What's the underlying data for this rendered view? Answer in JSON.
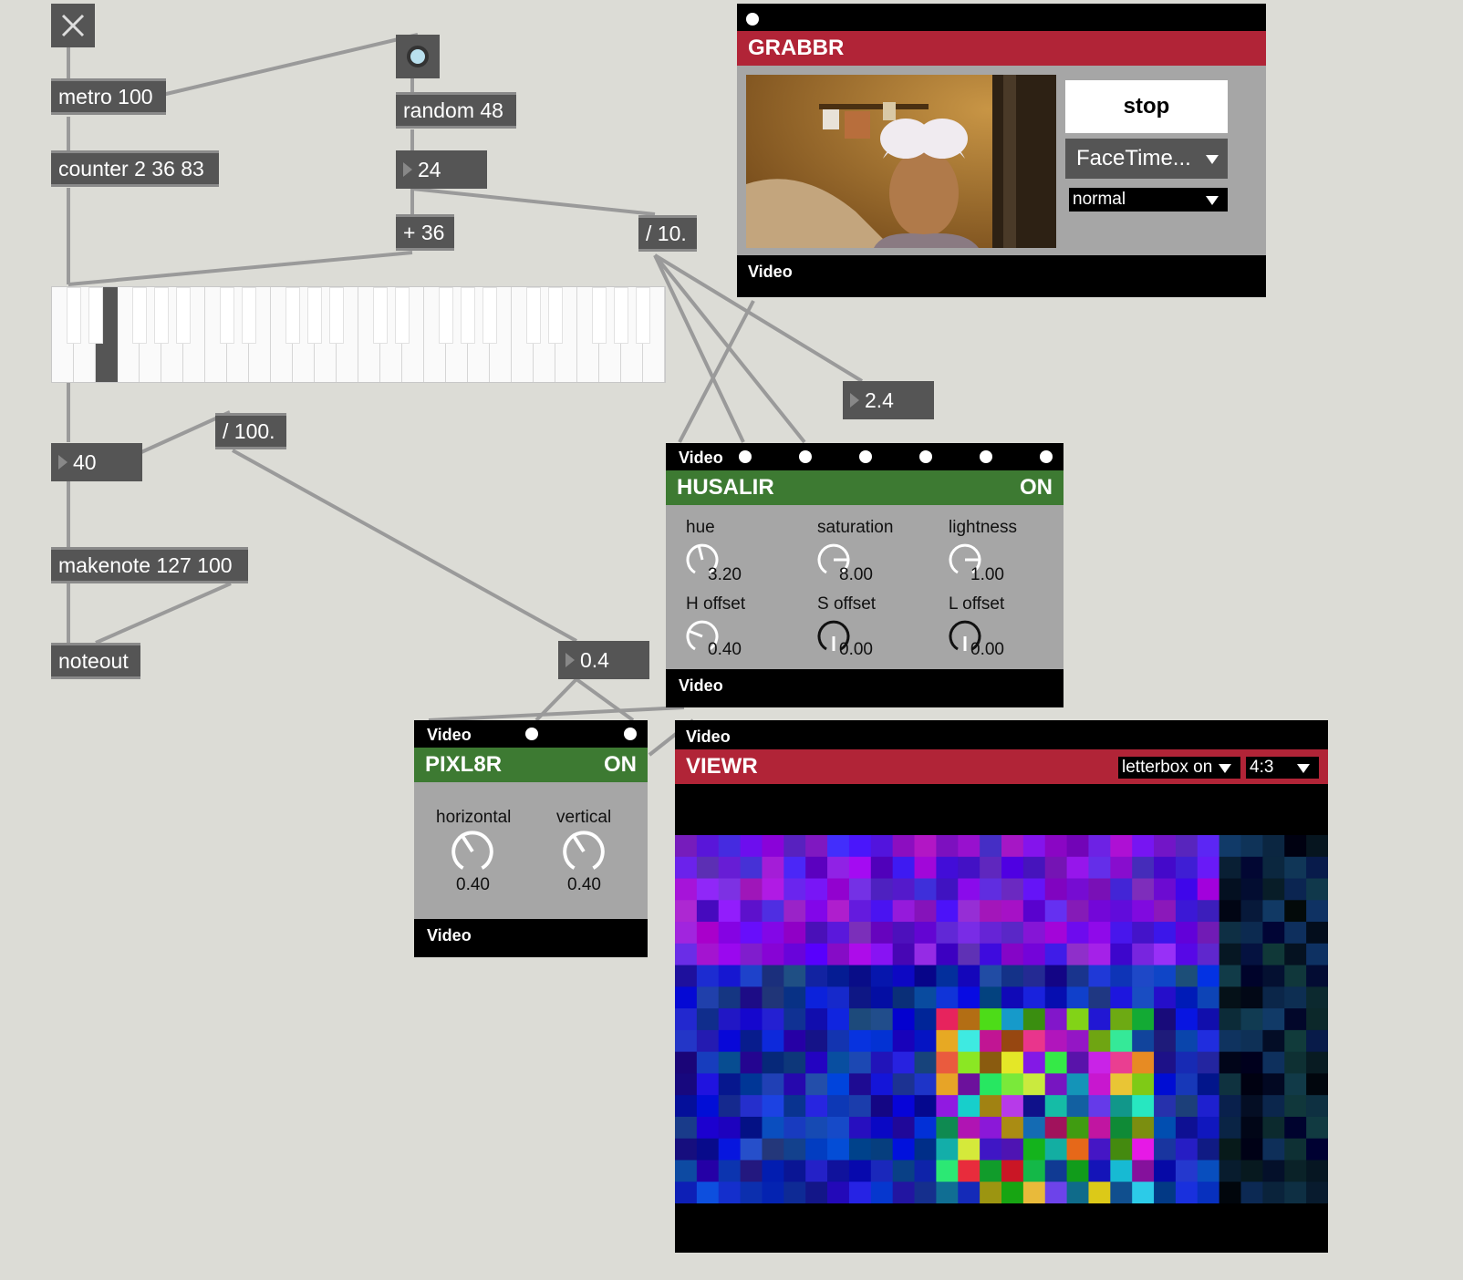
{
  "objects": {
    "metro": "metro 100",
    "random": "random 48",
    "counter": "counter 2 36 83",
    "plus": "+ 36",
    "div10": "/ 10.",
    "div100": "/ 100.",
    "makenote": "makenote 127 100",
    "noteout": "noteout"
  },
  "numbers": {
    "random_out": "24",
    "div10_out": "2.4",
    "note": "40",
    "div100_out": "0.4"
  },
  "grabbr": {
    "title": "GRABBR",
    "stop_label": "stop",
    "device": "FaceTime...",
    "mode": "normal",
    "footer": "Video"
  },
  "husalir": {
    "header": "Video",
    "title": "HUSALIR",
    "state": "ON",
    "footer": "Video",
    "knobs": [
      {
        "label": "hue",
        "value": "3.20"
      },
      {
        "label": "saturation",
        "value": "8.00"
      },
      {
        "label": "lightness",
        "value": "1.00"
      },
      {
        "label": "H offset",
        "value": "0.40"
      },
      {
        "label": "S offset",
        "value": "0.00"
      },
      {
        "label": "L offset",
        "value": "0.00"
      }
    ]
  },
  "pixl8r": {
    "header": "Video",
    "title": "PIXL8R",
    "state": "ON",
    "footer": "Video",
    "knobs": [
      {
        "label": "horizontal",
        "value": "0.40"
      },
      {
        "label": "vertical",
        "value": "0.40"
      }
    ]
  },
  "viewr": {
    "header": "Video",
    "title": "VIEWR",
    "letterbox": "letterbox on",
    "aspect": "4:3"
  },
  "colors": {
    "canvas": "#dcdcd6",
    "object": "#555555",
    "green_module": "#3d7a32",
    "red_module": "#b12437",
    "patch_cord": "#9a9a9a"
  }
}
